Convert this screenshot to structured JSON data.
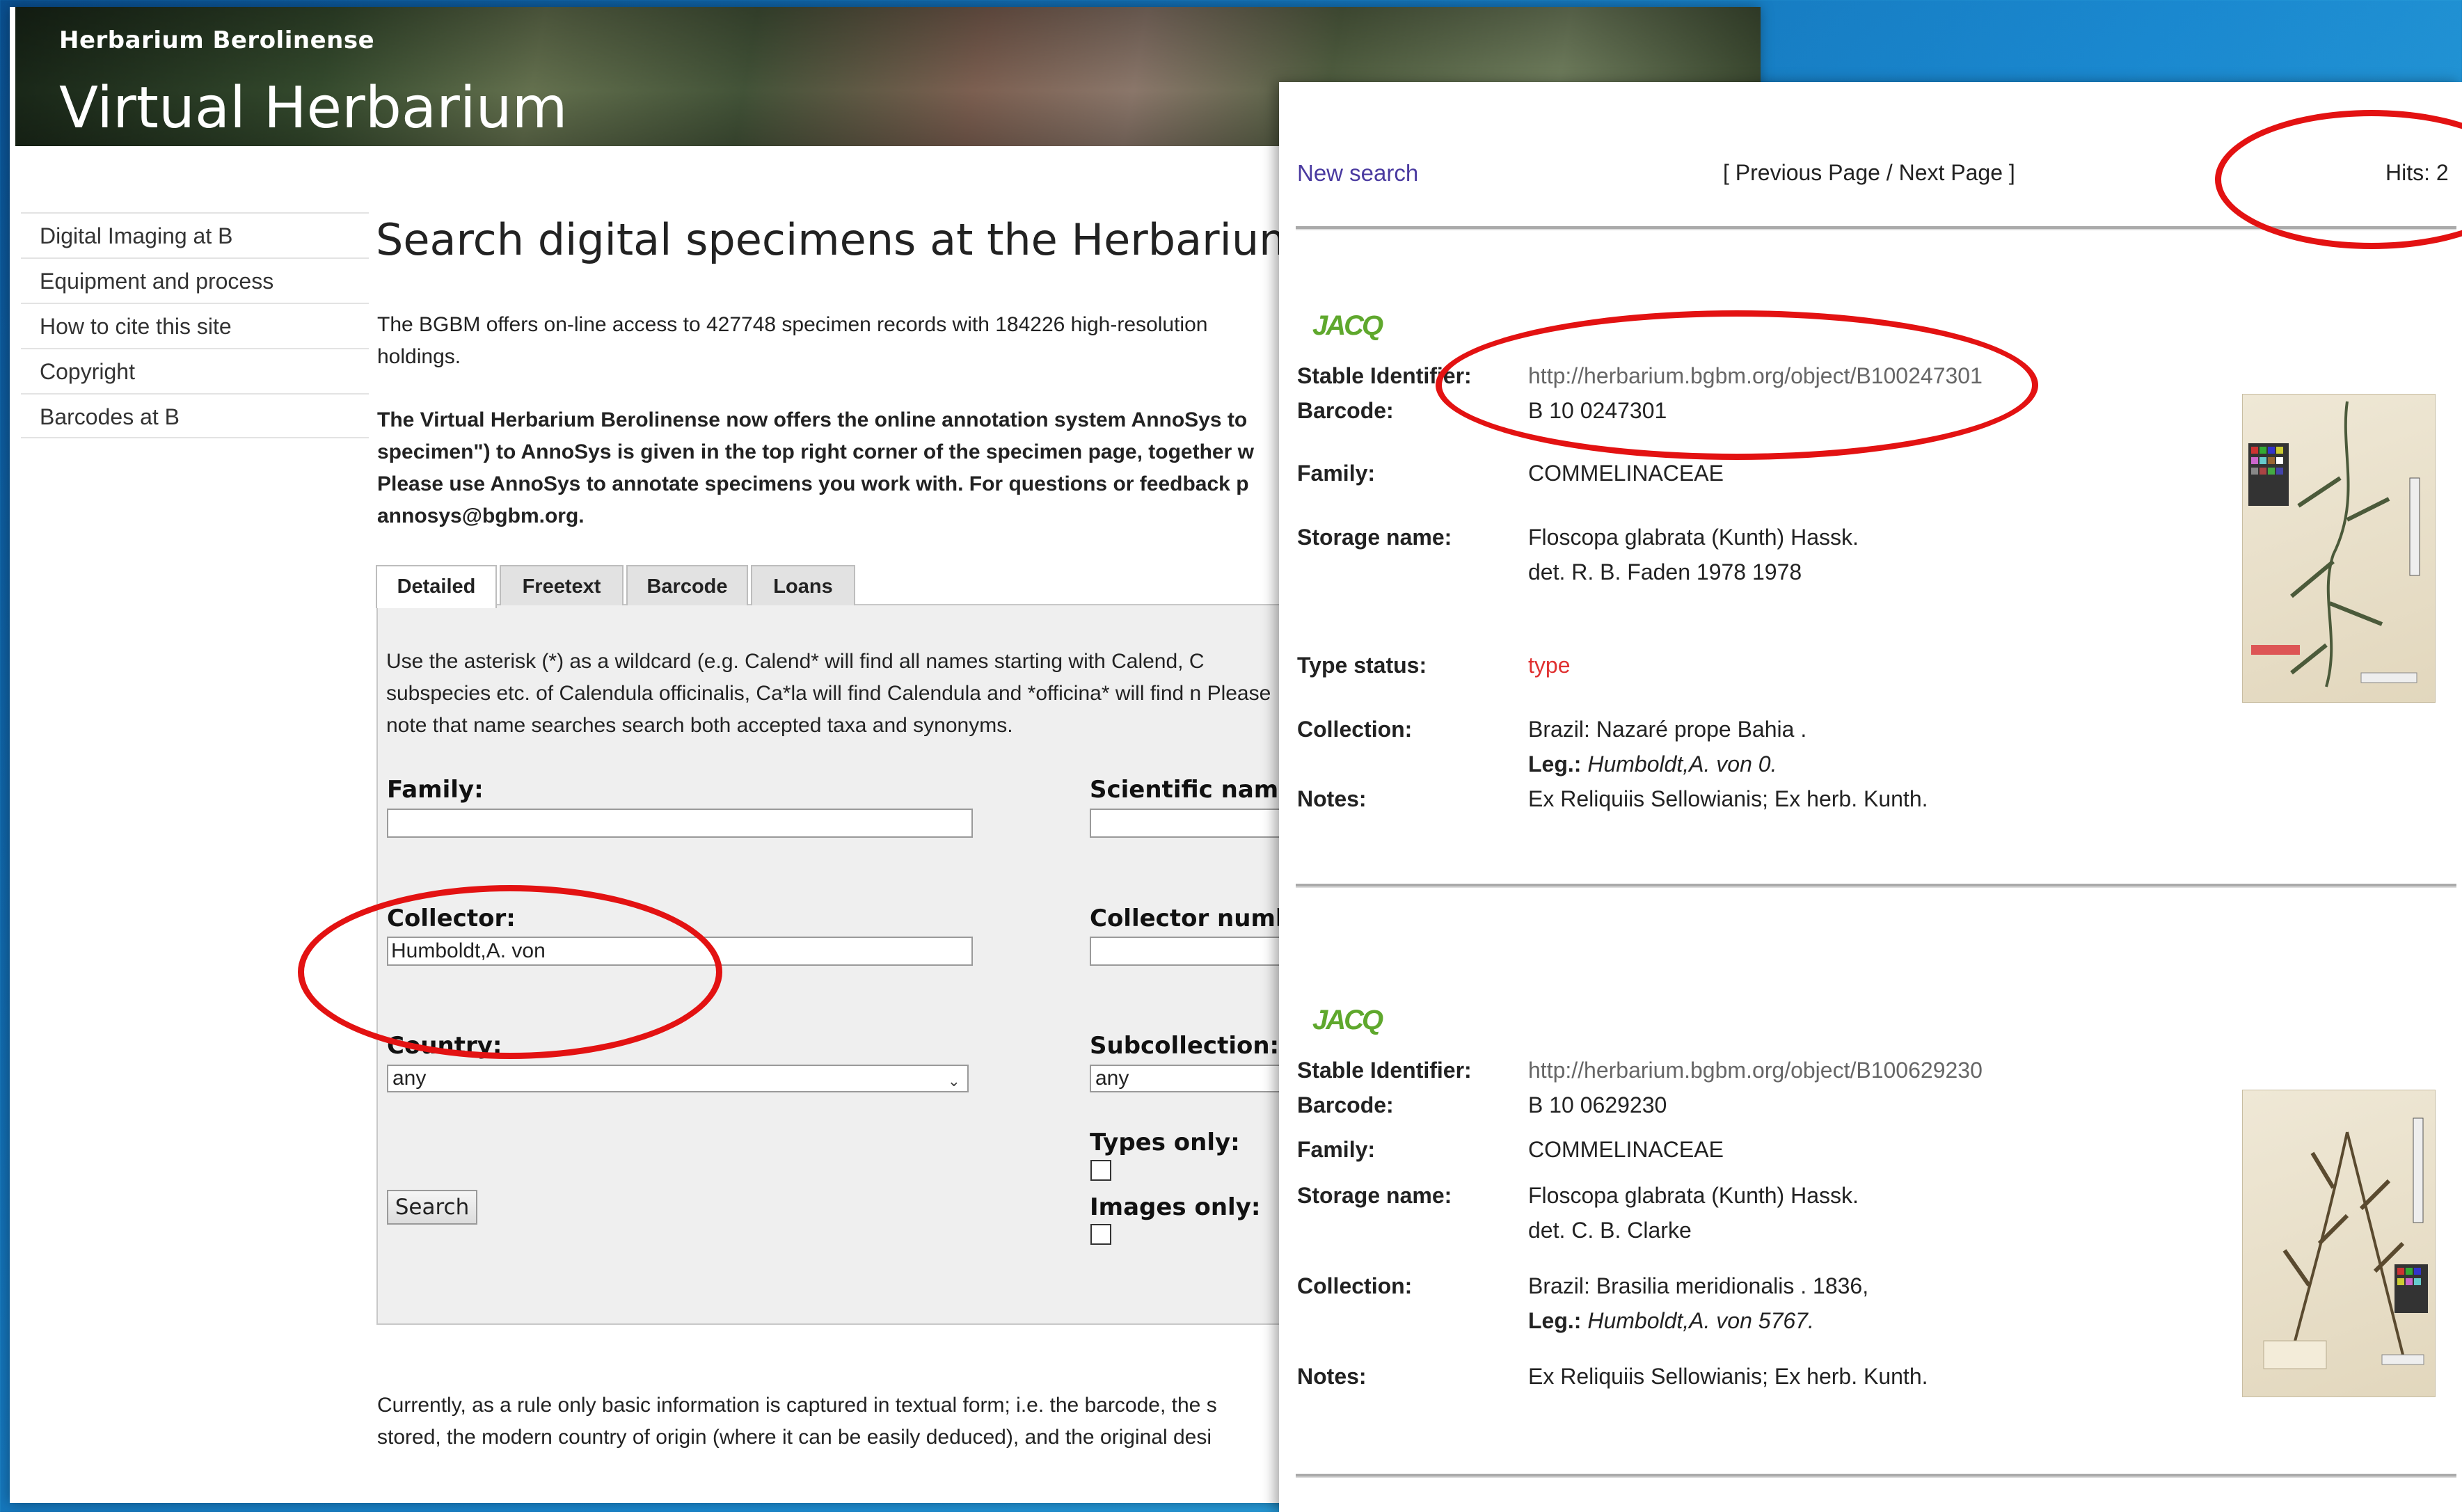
{
  "left": {
    "site_sub": "Herbarium Berolinense",
    "site_title": "Virtual Herbarium",
    "nav": [
      "Digital Imaging at B",
      "Equipment and process",
      "How to cite this site",
      "Copyright",
      "Barcodes at B"
    ],
    "heading": "Search digital specimens at the Herbarium",
    "intro": "The BGBM offers on-line access to 427748 specimen records with 184226 high-resolution holdings.",
    "annosys": "The Virtual Herbarium Berolinense now offers the online annotation system AnnoSys to specimen\") to AnnoSys is given in the top right corner of the specimen page, together w Please use AnnoSys to annotate specimens you work with. For questions or feedback p annosys@bgbm.org.",
    "tabs": [
      "Detailed",
      "Freetext",
      "Barcode",
      "Loans"
    ],
    "hint": "Use the asterisk (*) as a wildcard (e.g. Calend* will find all names starting with Calend, C subspecies etc. of Calendula officinalis, Ca*la will find Calendula and *officina* will find n Please note that name searches search both accepted taxa and synonyms.",
    "form": {
      "family_label": "Family:",
      "family_value": "",
      "sciname_label": "Scientific name:",
      "collector_label": "Collector:",
      "collector_value": "Humboldt,A. von",
      "collnum_label": "Collector numbe",
      "country_label": "Country:",
      "country_value": "any",
      "subcollection_label": "Subcollection:",
      "subcollection_value": "any",
      "types_label": "Types only:",
      "images_label": "Images only:",
      "search_button": "Search"
    },
    "footer": "Currently, as a rule only basic information is captured in textual form; i.e. the barcode, the s stored, the modern country of origin (where it can be easily deduced), and the original desi"
  },
  "right": {
    "new_search": "New search",
    "pager": "[ Previous Page / Next Page ]",
    "hits": "Hits: 2",
    "logo": "JACQ",
    "records": [
      {
        "stable_label": "Stable Identifier:",
        "stable_value": "http://herbarium.bgbm.org/object/B100247301",
        "barcode_label": "Barcode:",
        "barcode_value": "B 10 0247301",
        "family_label": "Family:",
        "family_value": "COMMELINACEAE",
        "storage_label": "Storage name:",
        "storage_value": "Floscopa glabrata (Kunth) Hassk.",
        "storage_det": "det. R. B. Faden 1978 1978",
        "type_label": "Type status:",
        "type_value": "type",
        "collection_label": "Collection:",
        "collection_value": "Brazil: Nazaré prope Bahia .",
        "leg_label": "Leg.:",
        "leg_value": "Humboldt,A. von 0.",
        "notes_label": "Notes:",
        "notes_value": "Ex Reliquiis Sellowianis; Ex herb. Kunth."
      },
      {
        "stable_label": "Stable Identifier:",
        "stable_value": "http://herbarium.bgbm.org/object/B100629230",
        "barcode_label": "Barcode:",
        "barcode_value": "B 10 0629230",
        "family_label": "Family:",
        "family_value": "COMMELINACEAE",
        "storage_label": "Storage name:",
        "storage_value": "Floscopa glabrata (Kunth) Hassk.",
        "storage_det": "det. C. B. Clarke",
        "collection_label": "Collection:",
        "collection_value": "Brazil: Brasilia meridionalis . 1836,",
        "leg_label": "Leg.:",
        "leg_value": "Humboldt,A. von 5767.",
        "notes_label": "Notes:",
        "notes_value": "Ex Reliquiis Sellowianis; Ex herb. Kunth."
      }
    ]
  }
}
